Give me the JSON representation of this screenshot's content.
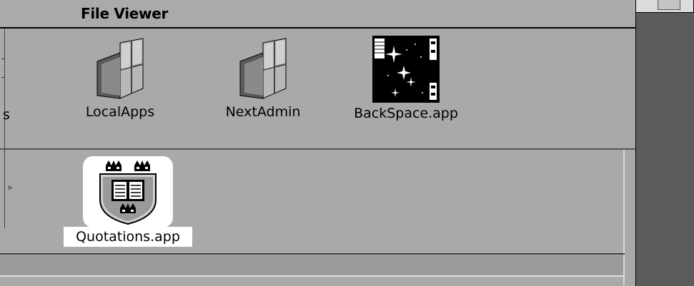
{
  "window": {
    "title": "File Viewer"
  },
  "mini_window": {
    "dots": "..."
  },
  "shelf": {
    "items": [
      {
        "label": "LocalApps",
        "icon": "folder-icon"
      },
      {
        "label": "NextAdmin",
        "icon": "folder-icon"
      },
      {
        "label": "BackSpace.app",
        "icon": "backspace-app-icon"
      }
    ],
    "clipped_label_fragment": "s"
  },
  "browser": {
    "selected_item": {
      "label": "Quotations.app",
      "icon": "quotations-app-icon"
    },
    "arrow": "▹"
  },
  "colors": {
    "window_bg": "#a9a9a9",
    "backdrop": "#5c5c5c",
    "selection": "#ffffff"
  }
}
